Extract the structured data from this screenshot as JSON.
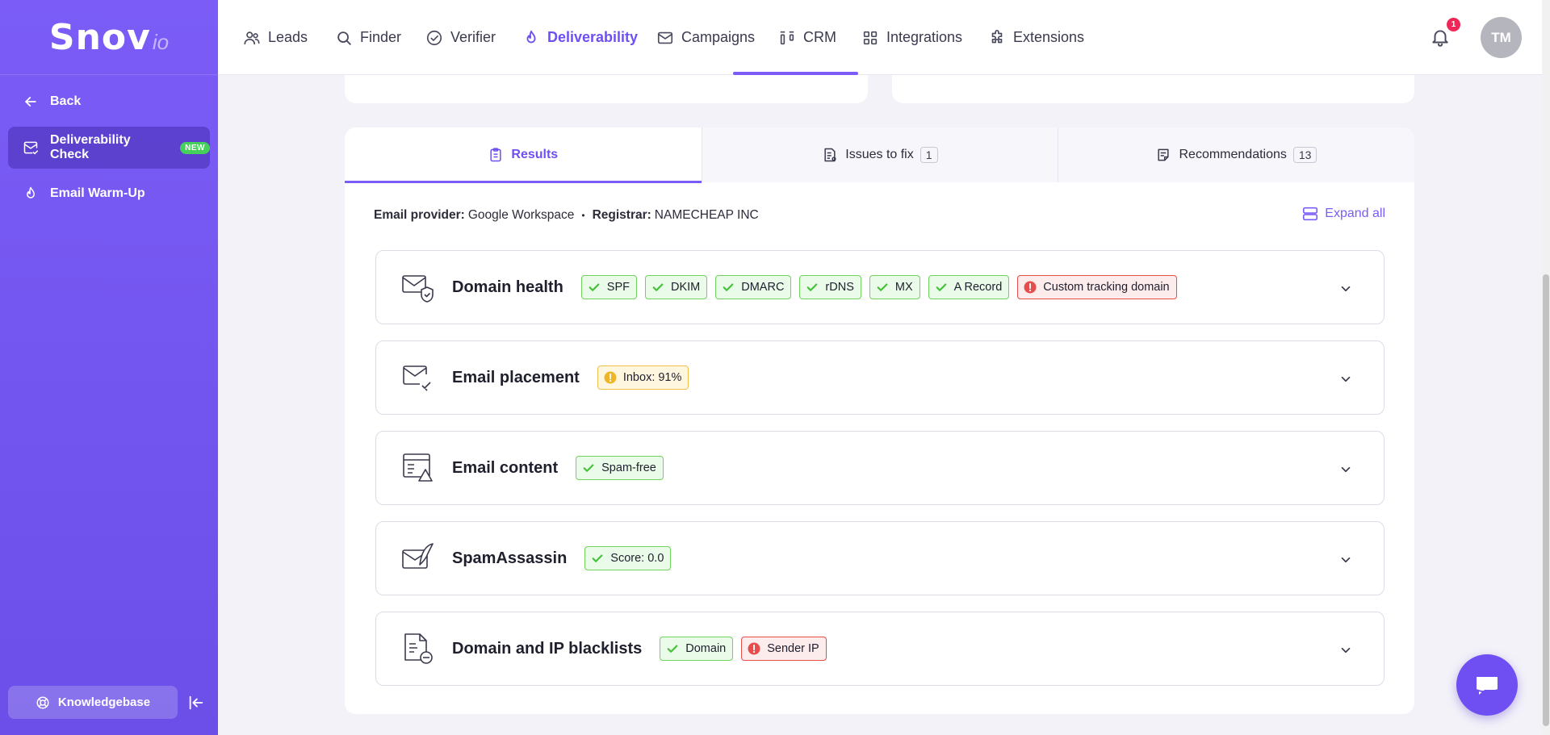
{
  "logo": {
    "main": "Snov",
    "sub": "io"
  },
  "sidebar": {
    "back_label": "Back",
    "items": [
      {
        "label": "Deliverability Check",
        "badge": "NEW"
      },
      {
        "label": "Email Warm-Up"
      }
    ],
    "knowledgebase_label": "Knowledgebase"
  },
  "nav": {
    "items": [
      {
        "label": "Leads"
      },
      {
        "label": "Finder"
      },
      {
        "label": "Verifier"
      },
      {
        "label": "Deliverability"
      },
      {
        "label": "Campaigns"
      },
      {
        "label": "CRM"
      },
      {
        "label": "Integrations"
      },
      {
        "label": "Extensions"
      }
    ],
    "active": "Deliverability",
    "notification_count": "1",
    "avatar_initials": "TM"
  },
  "tabs": [
    {
      "label": "Results",
      "count": ""
    },
    {
      "label": "Issues to fix",
      "count": "1"
    },
    {
      "label": "Recommendations",
      "count": "13"
    }
  ],
  "info": {
    "provider_label": "Email provider:",
    "provider_value": "Google Workspace",
    "separator": "•",
    "registrar_label": "Registrar:",
    "registrar_value": "NAMECHEAP INC",
    "expand_all": "Expand all"
  },
  "sections": [
    {
      "title": "Domain health",
      "chips": [
        {
          "label": "SPF",
          "status": "ok"
        },
        {
          "label": "DKIM",
          "status": "ok"
        },
        {
          "label": "DMARC",
          "status": "ok"
        },
        {
          "label": "rDNS",
          "status": "ok"
        },
        {
          "label": "MX",
          "status": "ok"
        },
        {
          "label": "A Record",
          "status": "ok"
        },
        {
          "label": "Custom tracking domain",
          "status": "error"
        }
      ]
    },
    {
      "title": "Email placement",
      "chips": [
        {
          "label": "Inbox: 91%",
          "status": "warning"
        }
      ]
    },
    {
      "title": "Email content",
      "chips": [
        {
          "label": "Spam-free",
          "status": "ok"
        }
      ]
    },
    {
      "title": "SpamAssassin",
      "chips": [
        {
          "label": "Score: 0.0",
          "status": "ok"
        }
      ]
    },
    {
      "title": "Domain and IP blacklists",
      "chips": [
        {
          "label": "Domain",
          "status": "ok"
        },
        {
          "label": "Sender IP",
          "status": "error"
        }
      ]
    }
  ],
  "colors": {
    "accent": "#7b5cf6",
    "ok": "#45c23a",
    "error": "#e64d4d",
    "warning": "#f0b429"
  }
}
